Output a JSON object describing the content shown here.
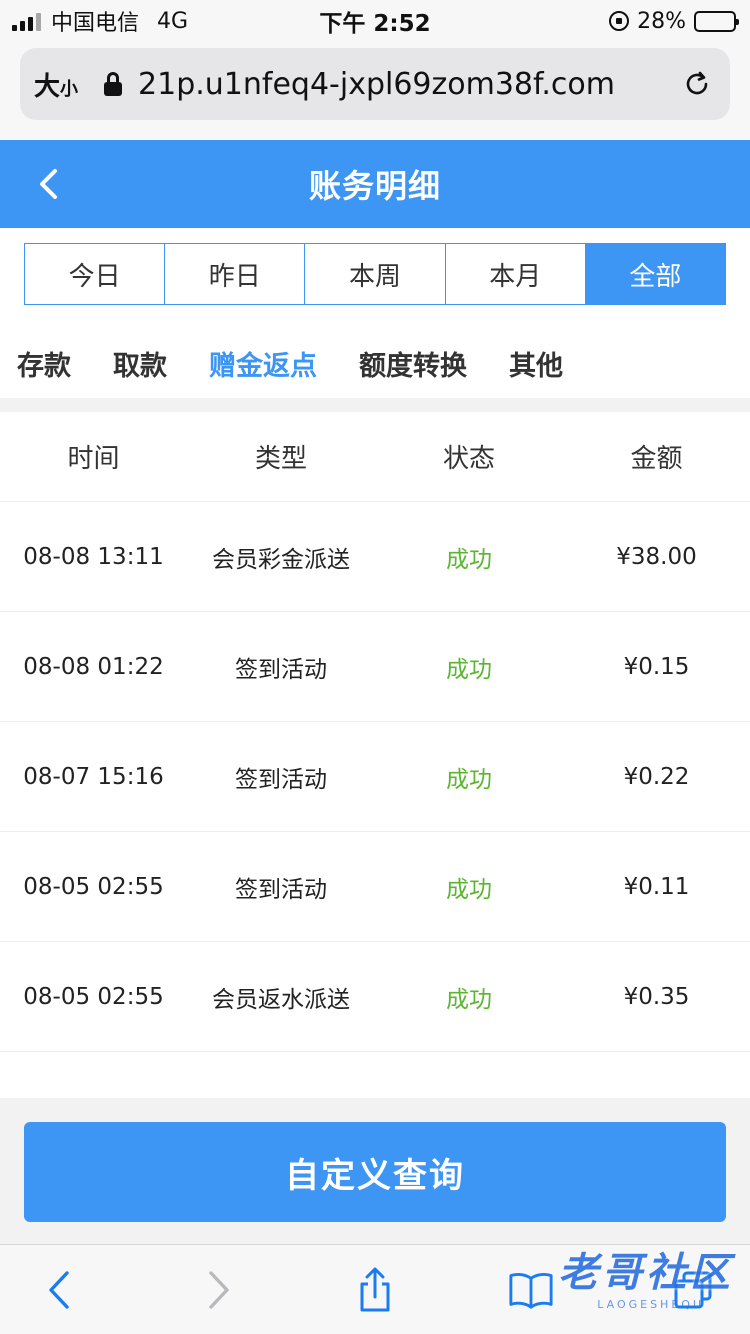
{
  "status_bar": {
    "carrier": "中国电信",
    "network": "4G",
    "time": "下午 2:52",
    "battery": "28%",
    "battery_level": 0.28
  },
  "browser": {
    "text_size_big": "大",
    "text_size_small": "小",
    "url": "21p.u1nfeq4-jxpl69zom38f.com"
  },
  "header": {
    "title": "账务明细"
  },
  "date_tabs": [
    {
      "label": "今日",
      "active": false
    },
    {
      "label": "昨日",
      "active": false
    },
    {
      "label": "本周",
      "active": false
    },
    {
      "label": "本月",
      "active": false
    },
    {
      "label": "全部",
      "active": true
    }
  ],
  "type_tabs": [
    {
      "label": "存款",
      "active": false
    },
    {
      "label": "取款",
      "active": false
    },
    {
      "label": "赠金返点",
      "active": true
    },
    {
      "label": "额度转换",
      "active": false
    },
    {
      "label": "其他",
      "active": false
    }
  ],
  "table": {
    "columns": [
      "时间",
      "类型",
      "状态",
      "金额"
    ],
    "rows": [
      {
        "time": "08-08 13:11",
        "type": "会员彩金派送",
        "status": "成功",
        "amount": "¥38.00"
      },
      {
        "time": "08-08 01:22",
        "type": "签到活动",
        "status": "成功",
        "amount": "¥0.15"
      },
      {
        "time": "08-07 15:16",
        "type": "签到活动",
        "status": "成功",
        "amount": "¥0.22"
      },
      {
        "time": "08-05 02:55",
        "type": "签到活动",
        "status": "成功",
        "amount": "¥0.11"
      },
      {
        "time": "08-05 02:55",
        "type": "会员返水派送",
        "status": "成功",
        "amount": "¥0.35"
      }
    ]
  },
  "query": {
    "button_label": "自定义查询"
  },
  "watermark": {
    "main": "老哥社区",
    "sub": "LAOGESHEQU"
  },
  "colors": {
    "accent": "#3d95f4",
    "success": "#5cb531"
  }
}
